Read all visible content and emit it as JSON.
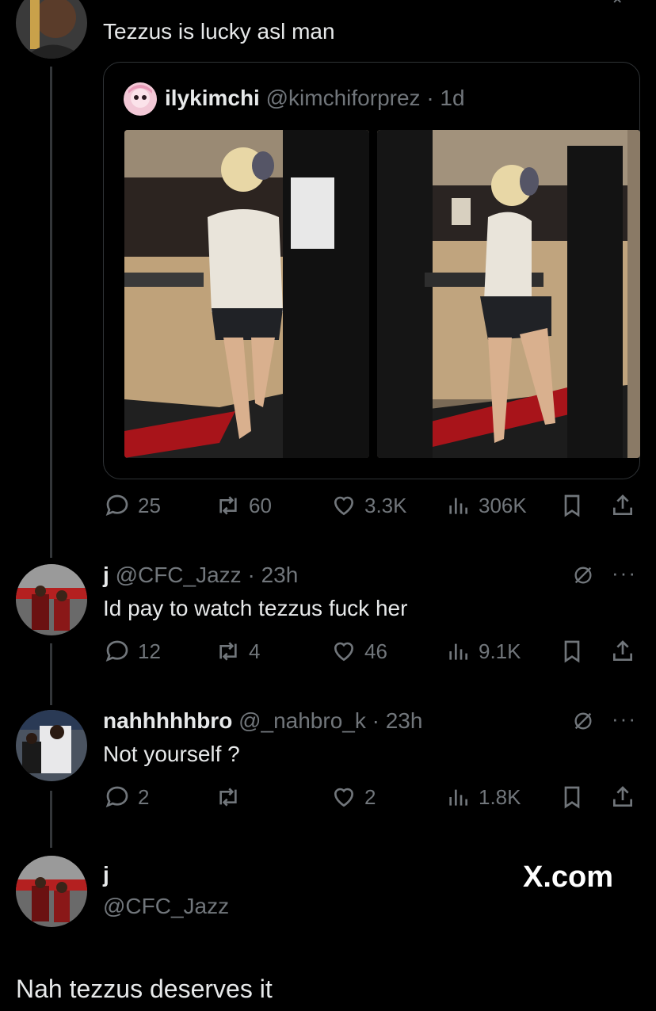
{
  "top_tweet": {
    "text": "Tezzus is lucky asl man"
  },
  "quoted": {
    "display_name": "ilykimchi",
    "handle": "@kimchiforprez",
    "time": "· 1d"
  },
  "top_actions": {
    "replies": "25",
    "reposts": "60",
    "likes": "3.3K",
    "views": "306K"
  },
  "reply1": {
    "display_name": "j",
    "handle": "@CFC_Jazz",
    "time": "· 23h",
    "text": "Id pay to watch tezzus fuck her",
    "replies": "12",
    "reposts": "4",
    "likes": "46",
    "views": "9.1K"
  },
  "reply2": {
    "display_name": "nahhhhhbro",
    "handle": "@_nahbro_k",
    "time": "· 23h",
    "text": "Not yourself ?",
    "replies": "2",
    "reposts": "",
    "likes": "2",
    "views": "1.8K"
  },
  "main_post": {
    "display_name": "j",
    "handle": "@CFC_Jazz",
    "text": "Nah tezzus deserves it"
  },
  "watermark": "X.com",
  "colors": {
    "background": "#000000",
    "text": "#e7e9ea",
    "muted": "#71767b",
    "border": "#2f3336"
  },
  "icons": [
    "reply-icon",
    "repost-icon",
    "like-icon",
    "views-icon",
    "bookmark-icon",
    "share-icon",
    "grok-icon",
    "more-icon"
  ]
}
